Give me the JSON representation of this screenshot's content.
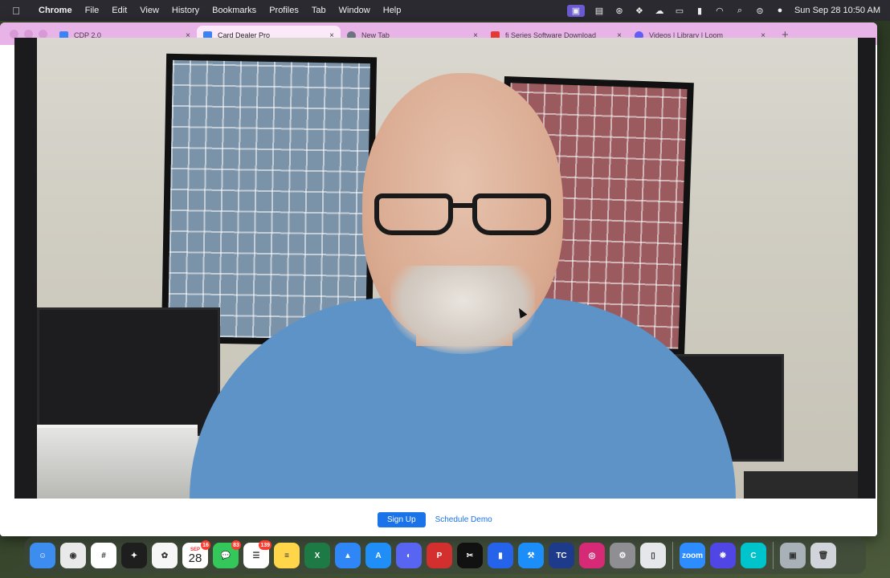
{
  "menubar": {
    "app_name": "Chrome",
    "menus": [
      "File",
      "Edit",
      "View",
      "History",
      "Bookmarks",
      "Profiles",
      "Tab",
      "Window",
      "Help"
    ],
    "clock": "Sun Sep 28  10:50 AM"
  },
  "browser": {
    "tabs": [
      {
        "title": "CDP 2.0",
        "active": false,
        "favicon_color": "#3b82f6"
      },
      {
        "title": "Card Dealer Pro",
        "active": true,
        "favicon_color": "#3b82f6"
      },
      {
        "title": "New Tab",
        "active": false,
        "favicon_color": "#6b7280"
      },
      {
        "title": "fi Series Software Download",
        "active": false,
        "favicon_color": "#e53935"
      },
      {
        "title": "Videos | Library | Loom",
        "active": false,
        "favicon_color": "#625df5"
      }
    ],
    "tab_close_glyph": "×",
    "new_tab_glyph": "+",
    "page": {
      "sign_up_label": "Sign Up",
      "schedule_demo_label": "Schedule Demo"
    }
  },
  "dock": {
    "items": [
      {
        "name": "finder",
        "color": "#3d8cf0",
        "glyph": "☺"
      },
      {
        "name": "chrome",
        "color": "#e9e9e9",
        "glyph": "◉"
      },
      {
        "name": "slack",
        "color": "#ffffff",
        "glyph": "#"
      },
      {
        "name": "figma",
        "color": "#1e1e1e",
        "glyph": "✦"
      },
      {
        "name": "photos",
        "color": "#f6f6f6",
        "glyph": "✿"
      },
      {
        "name": "calendar",
        "color": "#ffffff",
        "month": "SEP",
        "day": "28",
        "badge": "16"
      },
      {
        "name": "messages",
        "color": "#34c759",
        "glyph": "💬",
        "badge": "83"
      },
      {
        "name": "reminders",
        "color": "#ffffff",
        "glyph": "☰",
        "badge": "139"
      },
      {
        "name": "notes",
        "color": "#ffd54a",
        "glyph": "≡"
      },
      {
        "name": "excel",
        "color": "#1d7a44",
        "glyph": "X"
      },
      {
        "name": "keynote",
        "color": "#2f86f6",
        "glyph": "▲"
      },
      {
        "name": "app-store",
        "color": "#1f8ef7",
        "glyph": "A"
      },
      {
        "name": "discord",
        "color": "#5865f2",
        "glyph": "◐"
      },
      {
        "name": "pdf-expert",
        "color": "#d32f2f",
        "glyph": "P"
      },
      {
        "name": "capcut",
        "color": "#111111",
        "glyph": "✂"
      },
      {
        "name": "bookmarks",
        "color": "#2563eb",
        "glyph": "▮"
      },
      {
        "name": "xcode",
        "color": "#1c8ef9",
        "glyph": "⚒"
      },
      {
        "name": "trading-card",
        "color": "#1e3a8a",
        "glyph": "TC"
      },
      {
        "name": "instagram",
        "color": "#d62976",
        "glyph": "◎"
      },
      {
        "name": "system-settings",
        "color": "#8e8e93",
        "glyph": "⚙"
      },
      {
        "name": "simulator",
        "color": "#e5e7eb",
        "glyph": "▯"
      },
      {
        "name": "zoom",
        "color": "#2d8cff",
        "glyph": "zoom"
      },
      {
        "name": "perplexity",
        "color": "#4f46e5",
        "glyph": "❋"
      },
      {
        "name": "canva",
        "color": "#00c4cc",
        "glyph": "C"
      },
      {
        "name": "screenshot",
        "color": "#a8b0b8",
        "glyph": "▣"
      },
      {
        "name": "trash",
        "color": "#d1d5db",
        "glyph": "🗑"
      }
    ]
  }
}
